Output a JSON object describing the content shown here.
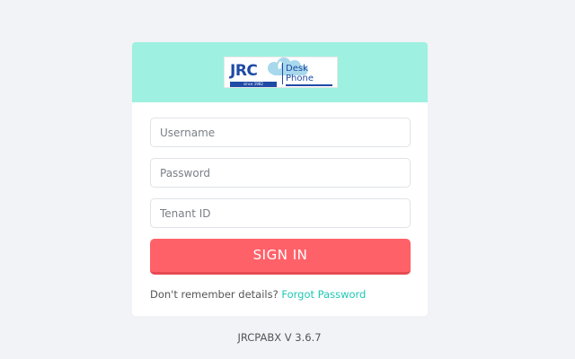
{
  "logo": {
    "brand": "JRC",
    "tagline": "since 1982",
    "product_line1": "Desk",
    "product_line2": "Phone",
    "icon": "cloud-phone-logo-icon"
  },
  "form": {
    "username_placeholder": "Username",
    "password_placeholder": "Password",
    "tenant_placeholder": "Tenant ID",
    "signin_label": "SIGN IN"
  },
  "help": {
    "prompt": "Don't remember details?",
    "link": "Forgot Password"
  },
  "version": "JRCPABX V 3.6.7",
  "colors": {
    "header_bg": "#9ef0e0",
    "button_bg": "#ff6169",
    "link": "#1fc8b4",
    "brand_blue": "#1f4aa5"
  }
}
